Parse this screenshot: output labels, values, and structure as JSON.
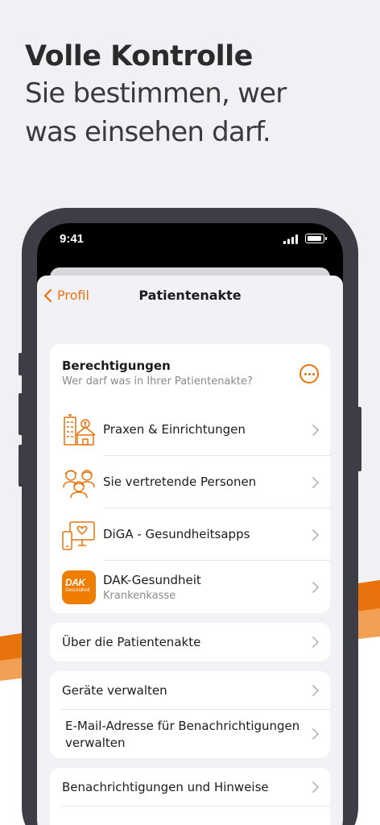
{
  "headline": {
    "title": "Volle Kontrolle",
    "subtitle_line1": "Sie bestimmen, wer",
    "subtitle_line2": "was einsehen darf."
  },
  "colors": {
    "accent": "#e8730c",
    "brand_orange": "#ef7d00",
    "background": "#f1f0f4"
  },
  "status_bar": {
    "time": "9:41",
    "icons": [
      "signal-icon",
      "battery-icon"
    ]
  },
  "nav": {
    "back_label": "Profil",
    "title": "Patientenakte"
  },
  "permissions": {
    "title": "Berechtigungen",
    "subtitle": "Wer darf was in Ihrer Patientenakte?",
    "items": [
      {
        "label": "Praxen & Einrichtungen",
        "icon": "hospital-icon"
      },
      {
        "label": "Sie vertretende Personen",
        "icon": "people-icon"
      },
      {
        "label": "DiGA - Gesundheitsapps",
        "icon": "devices-icon"
      },
      {
        "label": "DAK-Gesundheit",
        "sublabel": "Krankenkasse",
        "icon": "dak-logo",
        "logo_text": "DAK",
        "logo_subtext": "Gesundheit"
      }
    ]
  },
  "section_about": {
    "label": "Über die Patientenakte"
  },
  "section_devices": {
    "items": [
      {
        "label": "Geräte verwalten"
      },
      {
        "label_line1": "E-Mail-Adresse für Benachrichtigungen",
        "label_line2": "verwalten"
      }
    ]
  },
  "section_notifications": {
    "items": [
      {
        "label": "Benachrichtigungen und Hinweise"
      }
    ]
  }
}
